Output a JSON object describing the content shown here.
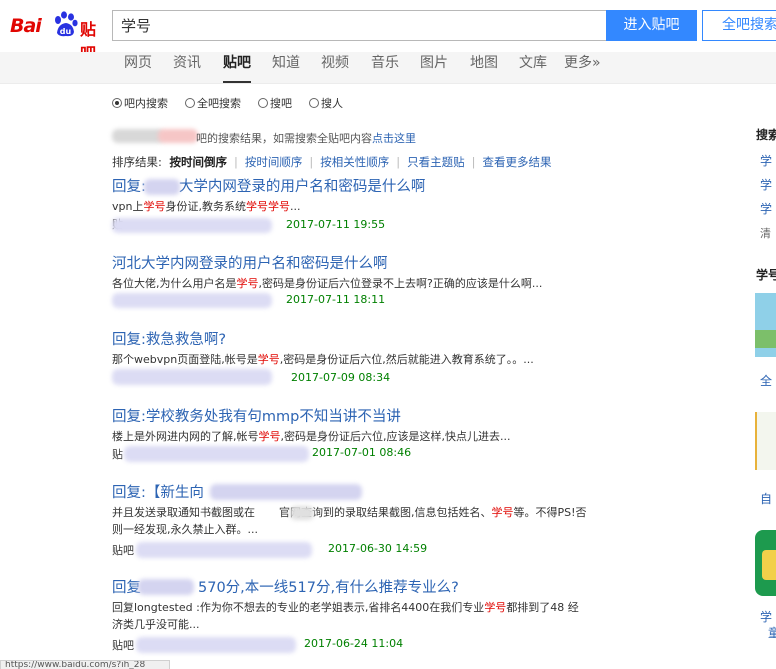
{
  "header": {
    "logo": {
      "bai": "Bai",
      "du": "du",
      "tieba": "贴吧"
    },
    "search_value": "学号",
    "enter_button": "进入贴吧",
    "all_search_button": "全吧搜索"
  },
  "nav": [
    "网页",
    "资讯",
    "贴吧",
    "知道",
    "视频",
    "音乐",
    "图片",
    "地图",
    "文库",
    "更多»"
  ],
  "nav_active": "贴吧",
  "radios": [
    {
      "label": "吧内搜索",
      "checked": true
    },
    {
      "label": "全吧搜索",
      "checked": false
    },
    {
      "label": "搜吧",
      "checked": false
    },
    {
      "label": "搜人",
      "checked": false
    }
  ],
  "scope_note": {
    "text": "吧的搜索结果，如需搜索全贴吧内容",
    "link": "点击这里"
  },
  "sort": {
    "label": "排序结果:",
    "current": "按时间倒序",
    "options": [
      "按时间顺序",
      "按相关性顺序",
      "只看主题贴",
      "查看更多结果"
    ]
  },
  "results": [
    {
      "title_pre": "回复:",
      "title": "大学内网登录的用户名和密码是什么啊",
      "desc": [
        [
          "vpn上",
          false
        ],
        [
          "学号",
          true
        ],
        [
          "身份证,教务系统",
          false
        ],
        [
          "学号学号",
          true
        ],
        [
          "...",
          false
        ]
      ],
      "meta_pre": "贴",
      "time": "2017-07-11 19:55"
    },
    {
      "title_pre": "",
      "title": "河北大学内网登录的用户名和密码是什么啊",
      "desc": [
        [
          "各位大佬,为什么用户名是",
          false
        ],
        [
          "学号",
          true
        ],
        [
          ",密码是身份证后六位登录不上去啊?正确的应该是什么啊...",
          false
        ]
      ],
      "meta_pre": "",
      "time": "2017-07-11 18:11"
    },
    {
      "title_pre": "",
      "title": "回复:救急救急啊?",
      "desc": [
        [
          "那个webvpn页面登陆,帐号是",
          false
        ],
        [
          "学号",
          true
        ],
        [
          ",密码是身份证后六位,然后就能进入教育系统了。。...",
          false
        ]
      ],
      "meta_pre": "",
      "time": "2017-07-09 08:34"
    },
    {
      "title_pre": "",
      "title": "回复:学校教务处我有句mmp不知当讲不当讲",
      "desc": [
        [
          "楼上是外网进内网的了解,帐号",
          false
        ],
        [
          "学号",
          true
        ],
        [
          ",密码是身份证后六位,应该是这样,快点儿进去...",
          false
        ]
      ],
      "meta_pre": "贴",
      "time": "2017-07-01 08:46"
    },
    {
      "title_pre": "回复:【新生向",
      "title": "",
      "desc": [
        [
          "并且发送录取通知书截图或在",
          false
        ],
        [
          "官网查询到的录取结果截图,信息包括姓名、",
          false
        ],
        [
          "学号",
          true
        ],
        [
          "等。不得PS!否则一经发现,永久禁止入群。...",
          false
        ]
      ],
      "meta_pre": "贴吧",
      "time": "2017-06-30 14:59"
    },
    {
      "title_pre": "回复",
      "title": "570分,本一线517分,有什么推荐专业么?",
      "desc": [
        [
          "回复longtested :作为你不想去的专业的老学姐表示,省排名4400在我们专业",
          false
        ],
        [
          "学号",
          true
        ],
        [
          "都排到了48 经济类几乎没可能...",
          false
        ]
      ],
      "meta_pre": "贴吧",
      "time": "2017-06-24 11:04"
    }
  ],
  "sidebar": {
    "heading1": "搜索",
    "links1": [
      "学",
      "学",
      "学"
    ],
    "gray1": "清",
    "heading2": "学号",
    "link_a": "全",
    "link_b": "自",
    "link_c": "学",
    "link_d": "童"
  },
  "statusbar": "https://www.baidu.com/s?ih_28",
  "colors": {
    "accent": "#3388ff",
    "link": "#2d64b3",
    "highlight": "#e10602",
    "time": "#008000"
  }
}
